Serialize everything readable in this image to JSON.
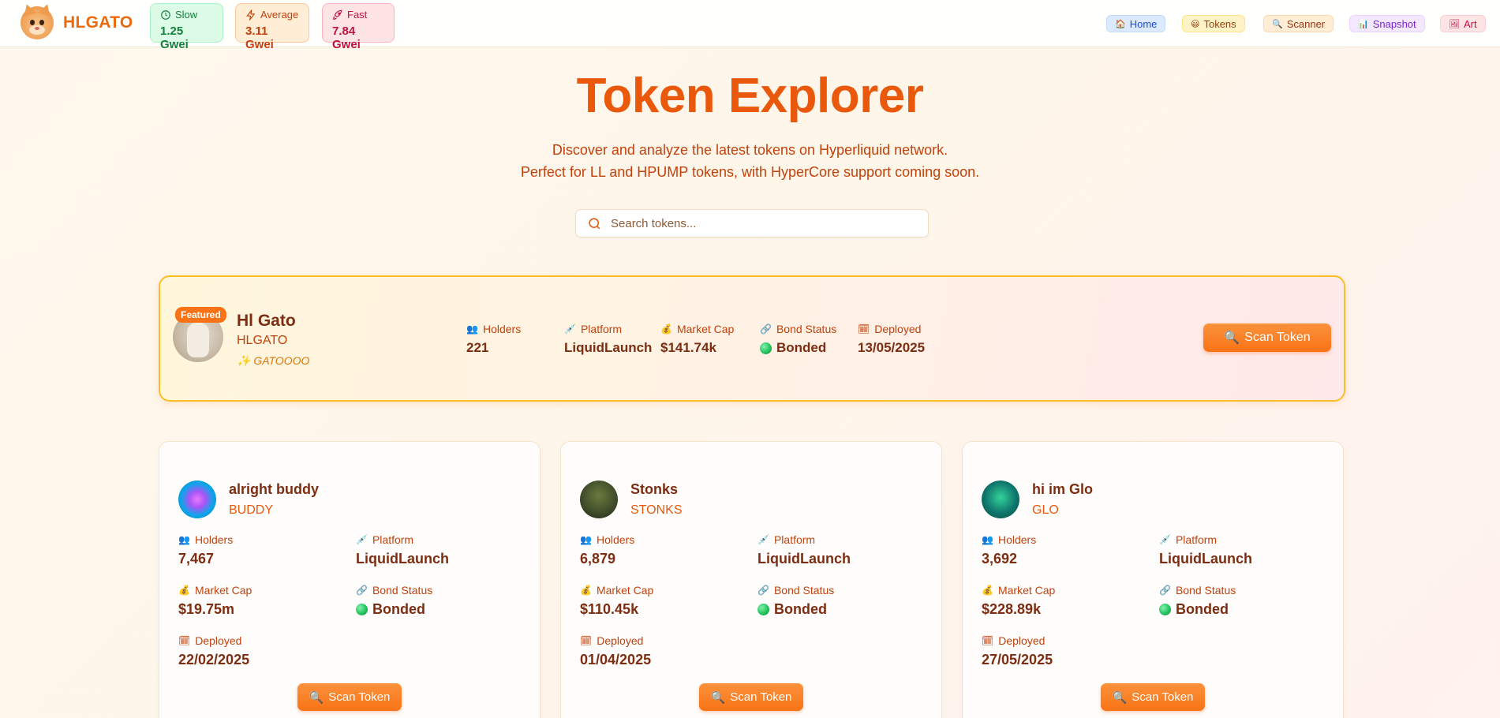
{
  "brand": {
    "name": "HLGATO"
  },
  "gas": {
    "slow": {
      "label": "Slow",
      "value": "1.25 Gwei"
    },
    "average": {
      "label": "Average",
      "value": "3.11 Gwei"
    },
    "fast": {
      "label": "Fast",
      "value": "7.84 Gwei"
    }
  },
  "nav": [
    {
      "icon": "🏠",
      "label": "Home"
    },
    {
      "icon": "😃",
      "label": "Tokens"
    },
    {
      "icon": "🔍",
      "label": "Scanner"
    },
    {
      "icon": "📊",
      "label": "Snapshot"
    },
    {
      "icon": "🖼",
      "label": "Art"
    }
  ],
  "hero": {
    "title": "Token Explorer",
    "subtitle_line1": "Discover and analyze the latest tokens on Hyperliquid network.",
    "subtitle_line2": "Perfect for LL and HPUMP tokens, with HyperCore support coming soon."
  },
  "search": {
    "placeholder": "Search tokens..."
  },
  "labels": {
    "holders": "Holders",
    "platform": "Platform",
    "market_cap": "Market Cap",
    "bond_status": "Bond Status",
    "deployed": "Deployed",
    "scan": "Scan Token"
  },
  "icons": {
    "holders": "👥",
    "platform": "💉",
    "market_cap": "💰",
    "bond_status": "🔗",
    "deployed": "🗓",
    "scan": "🔍"
  },
  "featured": {
    "badge": "Featured",
    "name": "Hl Gato",
    "symbol": "HLGATO",
    "tagline": "✨ GATOOOO",
    "holders": "221",
    "platform": "LiquidLaunch",
    "market_cap": "$141.74k",
    "bond_status": "Bonded",
    "deployed": "13/05/2025"
  },
  "tokens": [
    {
      "name": "alright buddy",
      "symbol": "BUDDY",
      "holders": "7,467",
      "platform": "LiquidLaunch",
      "market_cap": "$19.75m",
      "bond_status": "Bonded",
      "deployed": "22/02/2025",
      "avatar_color": "#0ea5e9"
    },
    {
      "name": "Stonks",
      "symbol": "STONKS",
      "holders": "6,879",
      "platform": "LiquidLaunch",
      "market_cap": "$110.45k",
      "bond_status": "Bonded",
      "deployed": "01/04/2025",
      "avatar_color": "#3f4a2a"
    },
    {
      "name": "hi im Glo",
      "symbol": "GLO",
      "holders": "3,692",
      "platform": "LiquidLaunch",
      "market_cap": "$228.89k",
      "bond_status": "Bonded",
      "deployed": "27/05/2025",
      "avatar_color": "#0f766e"
    }
  ],
  "colors": {
    "accent": "#ea580c",
    "brand": "#ea6a0c",
    "bonded": "#22c55e",
    "featured_border": "#fbbf24"
  }
}
